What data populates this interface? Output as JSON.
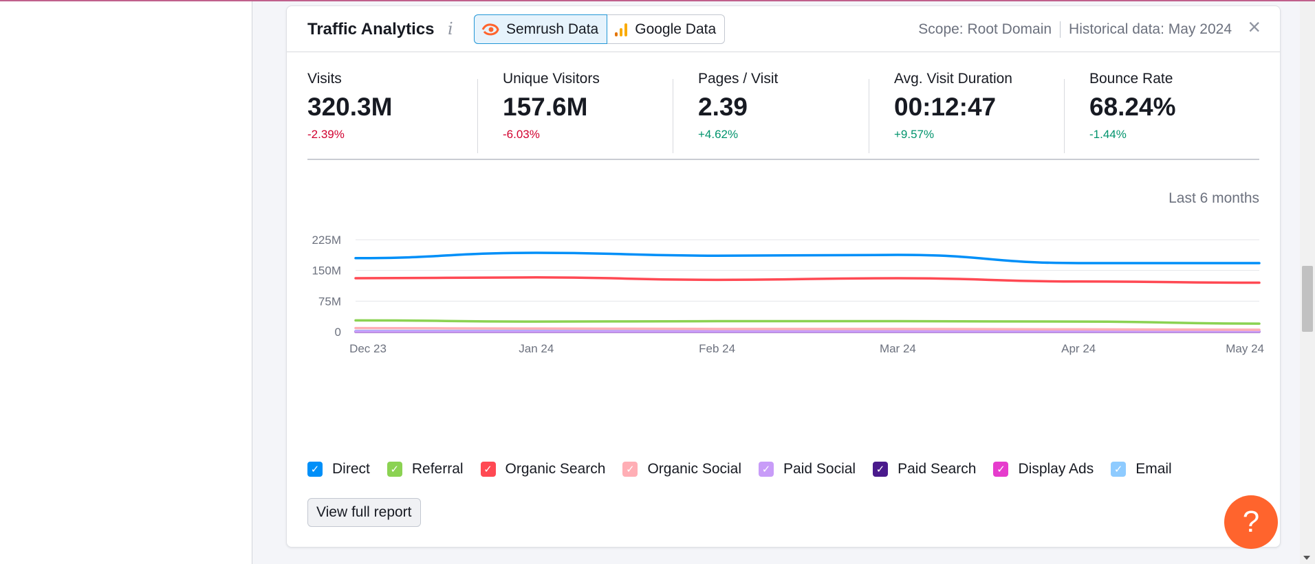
{
  "card": {
    "title": "Traffic Analytics",
    "info_icon": "i",
    "toggle": {
      "semrush_label": "Semrush Data",
      "google_label": "Google Data",
      "active": "Semrush Data"
    },
    "scope": "Scope: Root Domain",
    "historical": "Historical data: May 2024",
    "close_icon": "×"
  },
  "metrics": [
    {
      "label": "Visits",
      "value": "320.3M",
      "delta": "-2.39%"
    },
    {
      "label": "Unique Visitors",
      "value": "157.6M",
      "delta": "-6.03%"
    },
    {
      "label": "Pages / Visit",
      "value": "2.39",
      "delta": "+4.62%"
    },
    {
      "label": "Avg. Visit Duration",
      "value": "00:12:47",
      "delta": "+9.57%"
    },
    {
      "label": "Bounce Rate",
      "value": "68.24%",
      "delta": "-1.44%"
    }
  ],
  "range_label": "Last 6 months",
  "chart_data": {
    "type": "line",
    "categories": [
      "Dec 23",
      "Jan 24",
      "Feb 24",
      "Mar 24",
      "Apr 24",
      "May 24"
    ],
    "ylim": [
      0,
      225
    ],
    "yticks": [
      0,
      75,
      150,
      225
    ],
    "ytick_labels": [
      "0",
      "75M",
      "150M",
      "225M"
    ],
    "grid": true,
    "series": [
      {
        "name": "Direct",
        "color": "#008ff8",
        "values": [
          180,
          193,
          186,
          188,
          168,
          168
        ]
      },
      {
        "name": "Referral",
        "color": "#8bd252",
        "values": [
          28,
          25,
          26,
          26,
          25,
          20
        ]
      },
      {
        "name": "Organic Search",
        "color": "#ff4953",
        "values": [
          131,
          133,
          127,
          131,
          123,
          120
        ]
      },
      {
        "name": "Organic Social",
        "color": "#ffaeb5",
        "values": [
          9,
          8,
          7,
          7,
          6,
          5
        ]
      },
      {
        "name": "Paid Social",
        "color": "#c89cf8",
        "values": [
          1,
          1,
          1,
          1,
          1,
          1
        ]
      },
      {
        "name": "Paid Search",
        "color": "#4a1a8c",
        "values": [
          0.5,
          0.5,
          0.5,
          0.5,
          0.5,
          0.5
        ]
      },
      {
        "name": "Display Ads",
        "color": "#e63ccd",
        "values": [
          0.3,
          0.3,
          0.3,
          0.3,
          0.3,
          0.3
        ]
      },
      {
        "name": "Email",
        "color": "#8ecbff",
        "values": [
          2,
          2,
          2,
          2,
          2,
          2
        ]
      }
    ]
  },
  "report_button": "View full report",
  "help_icon": "?"
}
